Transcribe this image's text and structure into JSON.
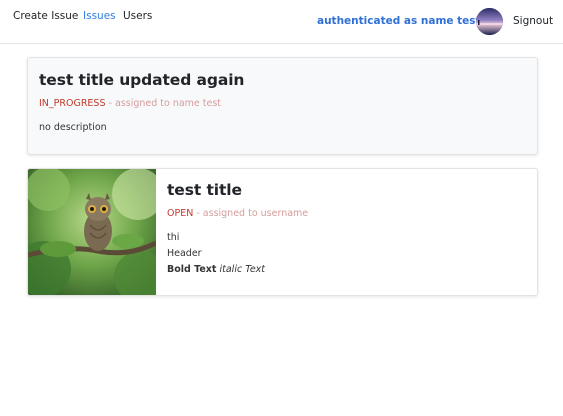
{
  "nav": {
    "create_issue": "Create Issue",
    "issues": "Issues",
    "users": "Users",
    "auth_text": "authenticated as name test",
    "signout": "Signout",
    "active_color": "#2f7fe0"
  },
  "issues": [
    {
      "title": "test title updated again",
      "status": "IN_PROGRESS",
      "assignment": " - assigned to name test",
      "description": "no description"
    },
    {
      "title": "test title",
      "status": "OPEN",
      "assignment": " - assigned to username",
      "body_lines": [
        "thi",
        "Header"
      ],
      "bold_text": "Bold Text",
      "italic_text": "italic Text",
      "image": "owl-photo"
    }
  ],
  "colors": {
    "status": "#c0392b",
    "assignment": "#d69c9c",
    "link_blue": "#2f6fd6"
  }
}
